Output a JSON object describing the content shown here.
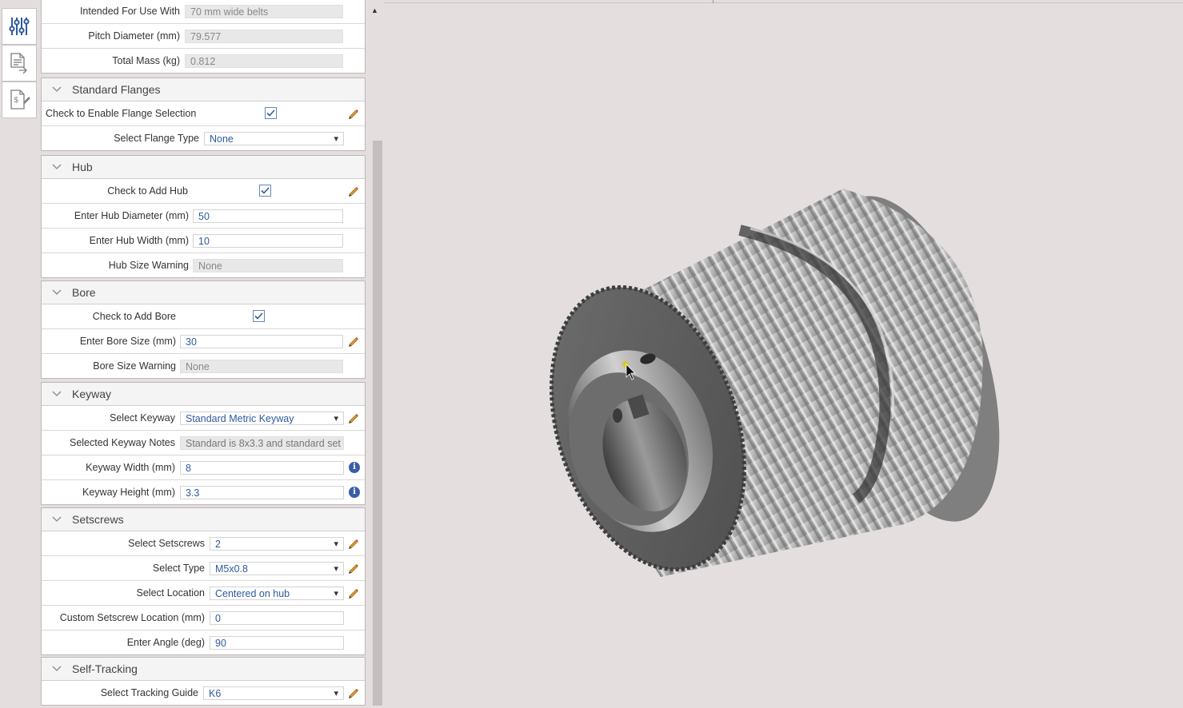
{
  "specs": [
    {
      "label": "Intended For Use With",
      "value": "70 mm wide belts"
    },
    {
      "label": "Pitch Diameter (mm)",
      "value": "79.577"
    },
    {
      "label": "Total Mass (kg)",
      "value": "0.812"
    }
  ],
  "flanges": {
    "title": "Standard Flanges",
    "enable_label": "Check to Enable Flange Selection",
    "type_label": "Select Flange Type",
    "type_value": "None"
  },
  "hub": {
    "title": "Hub",
    "add_label": "Check to Add Hub",
    "diameter_label": "Enter Hub Diameter (mm)",
    "diameter_value": "50",
    "width_label": "Enter Hub Width (mm)",
    "width_value": "10",
    "warning_label": "Hub Size Warning",
    "warning_value": "None"
  },
  "bore": {
    "title": "Bore",
    "add_label": "Check to Add Bore",
    "size_label": "Enter Bore Size (mm)",
    "size_value": "30",
    "warning_label": "Bore Size Warning",
    "warning_value": "None"
  },
  "keyway": {
    "title": "Keyway",
    "select_label": "Select Keyway",
    "select_value": "Standard Metric Keyway",
    "notes_label": "Selected Keyway Notes",
    "notes_value": "Standard is 8x3.3 and standard set",
    "width_label": "Keyway Width (mm)",
    "width_value": "8",
    "height_label": "Keyway Height (mm)",
    "height_value": "3.3"
  },
  "setscrews": {
    "title": "Setscrews",
    "count_label": "Select Setscrews",
    "count_value": "2",
    "type_label": "Select Type",
    "type_value": "M5x0.8",
    "location_label": "Select Location",
    "location_value": "Centered on hub",
    "custom_label": "Custom Setscrew Location (mm)",
    "custom_value": "0",
    "angle_label": "Enter Angle (deg)",
    "angle_value": "90"
  },
  "tracking": {
    "title": "Self-Tracking",
    "guide_label": "Select Tracking Guide",
    "guide_value": "K6"
  },
  "icons": {
    "rail": [
      "sliders-icon",
      "document-export-icon",
      "price-quote-icon"
    ],
    "edit": "pencil-icon",
    "info": "info-icon",
    "info_glyph": "i",
    "collapse": "chevron-down-icon"
  },
  "colors": {
    "background": "#e4dfde",
    "accent_blue": "#2d5a9e",
    "pencil": "#e0962a",
    "info": "#3a5ea8"
  }
}
